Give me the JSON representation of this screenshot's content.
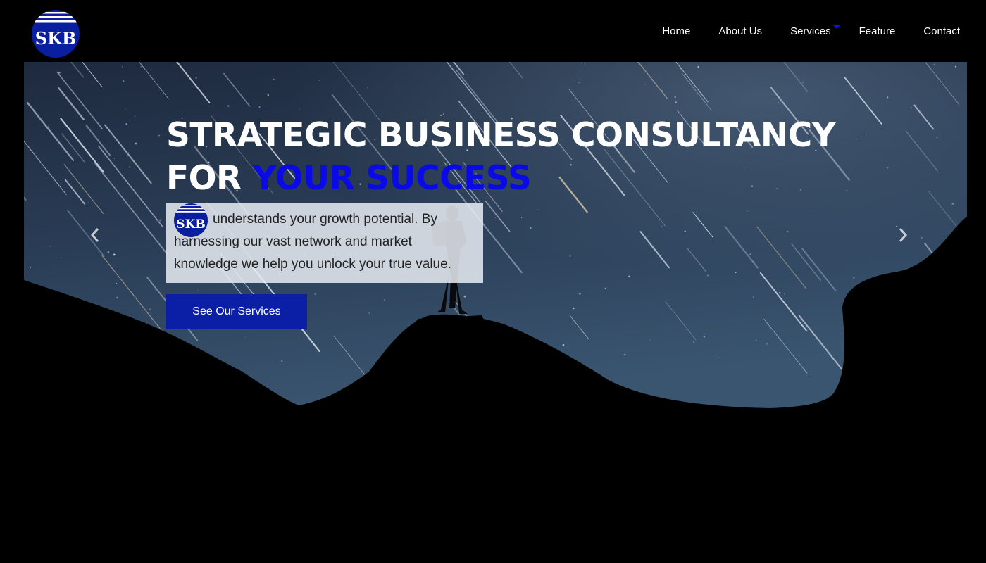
{
  "brand": {
    "logo_text": "SKB"
  },
  "nav": {
    "items": [
      {
        "label": "Home"
      },
      {
        "label": "About Us"
      },
      {
        "label": "Services"
      },
      {
        "label": "Feature"
      },
      {
        "label": "Contact"
      }
    ]
  },
  "hero": {
    "headline_line1": "STRATEGIC BUSINESS CONSULTANCY",
    "headline_for": "FOR",
    "headline_accent": "YOUR SUCCESS",
    "blurb_text": "understands your growth potential. By harnessing our vast network and market knowledge we help you unlock your true value.",
    "cta_label": "See Our Services"
  },
  "icons": {
    "prev": "chevron-left-icon",
    "next": "chevron-right-icon",
    "dropdown": "caret-down-icon"
  },
  "colors": {
    "accent": "#0a0ae6",
    "button": "#0b1fa6",
    "logo": "#0a1fa0",
    "background": "#000000"
  }
}
